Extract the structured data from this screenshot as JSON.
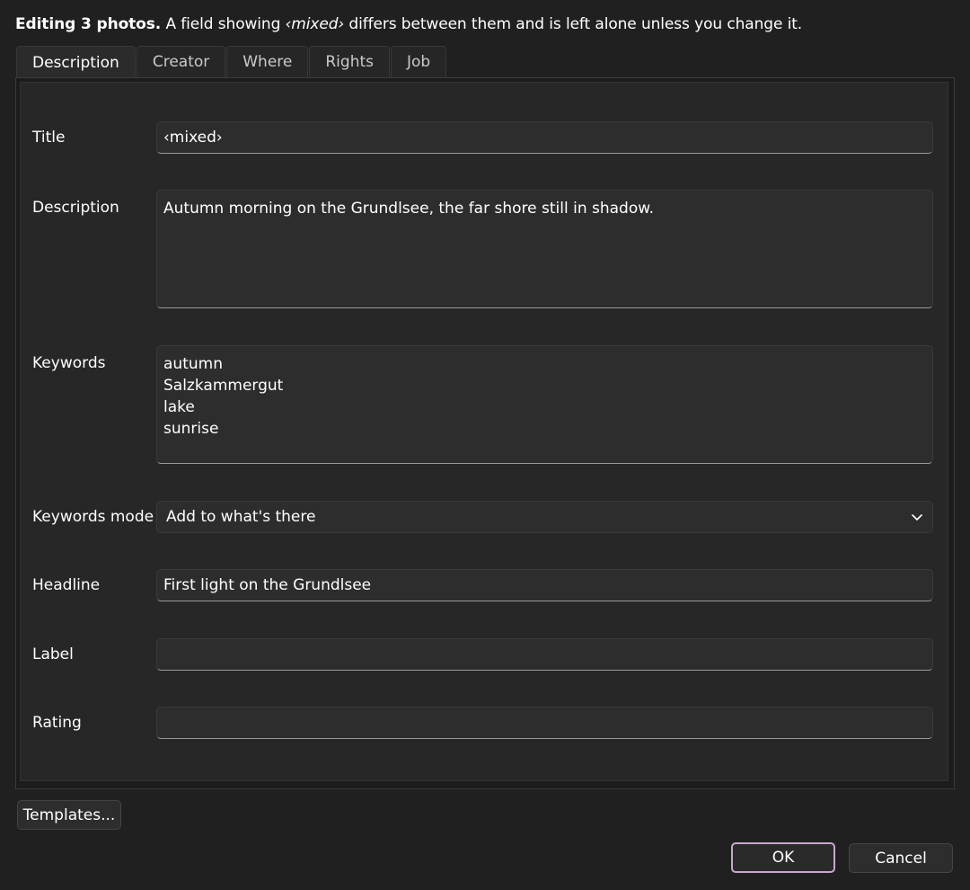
{
  "intro": {
    "bold": "Editing 3 photos.",
    "pre": " A field showing ",
    "mixed": "‹mixed›",
    "post": " differs between them and is left alone unless you change it."
  },
  "tabs": [
    {
      "label": "Description",
      "active": true
    },
    {
      "label": "Creator"
    },
    {
      "label": "Where"
    },
    {
      "label": "Rights"
    },
    {
      "label": "Job"
    }
  ],
  "fields": {
    "title": {
      "label": "Title",
      "value": "‹mixed›"
    },
    "description": {
      "label": "Description",
      "value": "Autumn morning on the Grundlsee, the far shore still in shadow."
    },
    "keywords": {
      "label": "Keywords",
      "values": [
        "autumn",
        "Salzkammergut",
        "lake",
        "sunrise"
      ]
    },
    "keywords_mode": {
      "label": "Keywords mode",
      "value": "Add to what's there"
    },
    "headline": {
      "label": "Headline",
      "value": "First light on the Grundlsee"
    },
    "label": {
      "label": "Label",
      "value": ""
    },
    "rating": {
      "label": "Rating",
      "value": ""
    }
  },
  "buttons": {
    "templates": "Templates...",
    "ok": "OK",
    "cancel": "Cancel"
  },
  "icons": {
    "dropdown": "chevron-down-icon"
  }
}
